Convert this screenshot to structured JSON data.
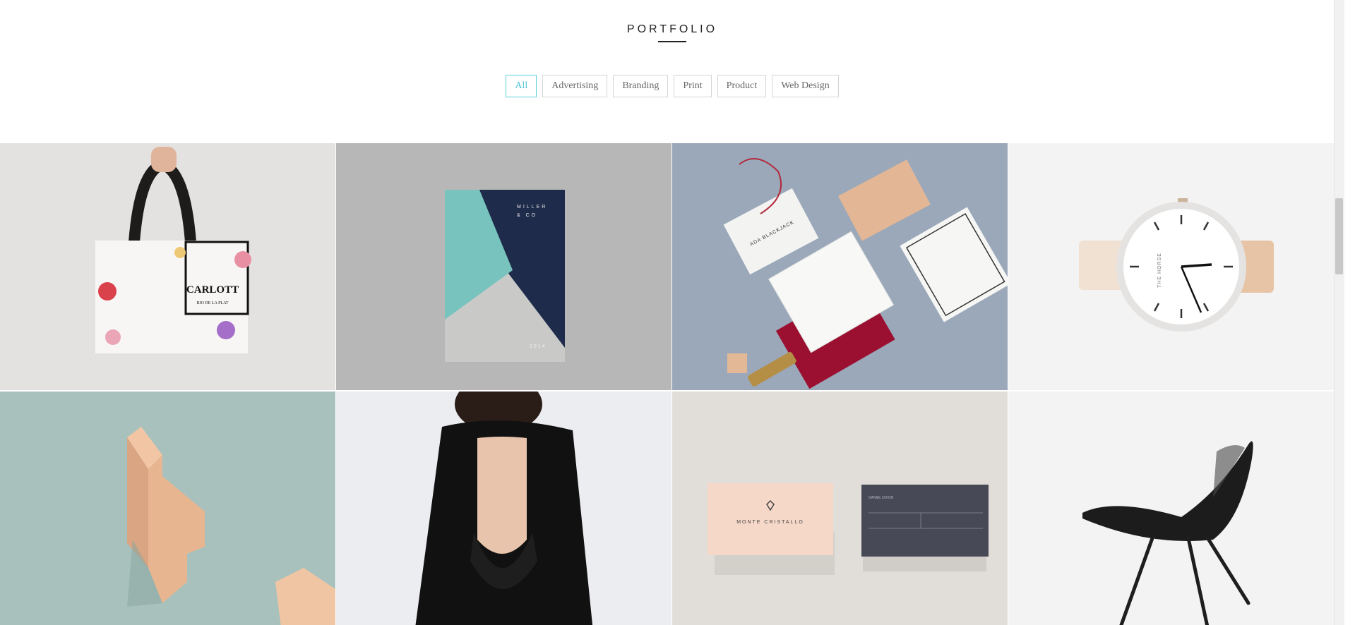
{
  "section": {
    "title": "PORTFOLIO"
  },
  "filters": [
    {
      "label": "All",
      "active": true
    },
    {
      "label": "Advertising",
      "active": false
    },
    {
      "label": "Branding",
      "active": false
    },
    {
      "label": "Print",
      "active": false
    },
    {
      "label": "Product",
      "active": false
    },
    {
      "label": "Web Design",
      "active": false
    }
  ],
  "portfolio": {
    "items": [
      {
        "subject": "shopping-bag",
        "bag_text": "CARLOTT",
        "bag_subtext": "RIO DE LA PLAT"
      },
      {
        "subject": "brochure",
        "brand": "MILLER",
        "brand2": "& CO",
        "year": "2 0 1 4"
      },
      {
        "subject": "stationery",
        "brand": "ADA BLACKJACK"
      },
      {
        "subject": "watch",
        "brand": "THE HORSE"
      },
      {
        "subject": "wood-object"
      },
      {
        "subject": "black-dress"
      },
      {
        "subject": "business-cards",
        "brand": "MONTE CRISTALLO",
        "name": "DANIEL DIXON"
      },
      {
        "subject": "chair"
      }
    ]
  },
  "colors": {
    "accent": "#4cc4d6"
  }
}
